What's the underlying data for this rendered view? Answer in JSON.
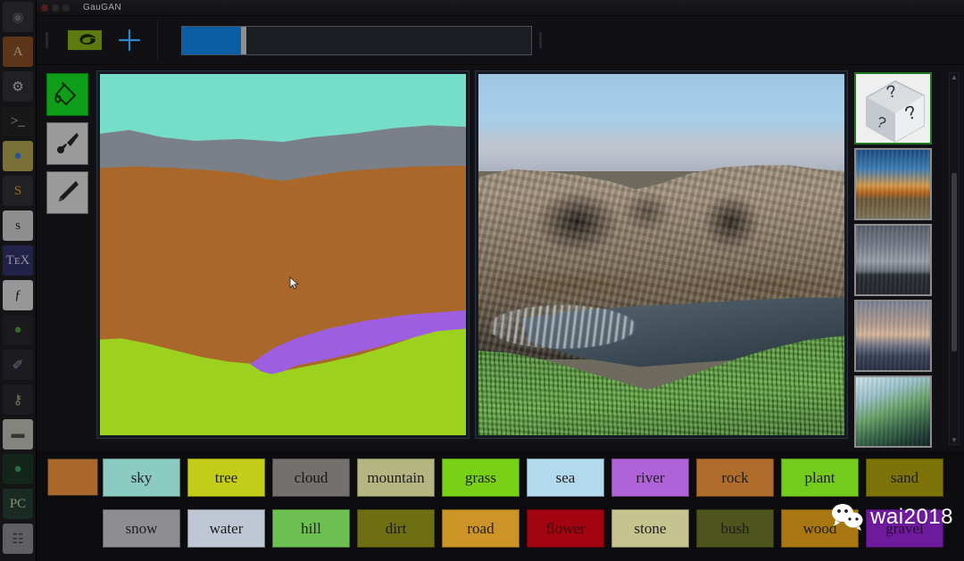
{
  "window": {
    "title": "GauGAN",
    "traffic_lights": [
      "close-button",
      "minimize-button",
      "maximize-button"
    ]
  },
  "toolbar": {
    "brand_icon": "nvidia-eye-logo",
    "new_icon": "plus-icon",
    "slider": {
      "name": "brush-size-slider",
      "value_percent": 17
    }
  },
  "tools": [
    {
      "name": "paint-bucket",
      "icon": "paint-bucket-icon",
      "active": true
    },
    {
      "name": "paintbrush",
      "icon": "paintbrush-icon",
      "active": false
    },
    {
      "name": "pencil",
      "icon": "pencil-icon",
      "active": false
    }
  ],
  "segmentation_canvas": {
    "name": "segmentation-canvas",
    "regions": [
      {
        "label": "sky",
        "color": "#76ddc9"
      },
      {
        "label": "cloud",
        "color": "#7b8088"
      },
      {
        "label": "rock",
        "color": "#a9672a"
      },
      {
        "label": "river",
        "color": "#9d5fe0"
      },
      {
        "label": "tree",
        "color": "#9cd120"
      }
    ],
    "cursor": "arrow-cursor"
  },
  "output_canvas": {
    "name": "generated-image-canvas",
    "description": "photorealistic rocky cliff with river and green grass under blue sky"
  },
  "styles": {
    "scrollbar": {
      "up_arrow": "▲",
      "down_arrow": "▼"
    },
    "thumbnails": [
      {
        "name": "random-style",
        "icon": "question-dice-icon",
        "selected": true
      },
      {
        "name": "style-sunset-lake",
        "selected": false
      },
      {
        "name": "style-overcast-sea",
        "selected": false
      },
      {
        "name": "style-dusk-city",
        "selected": false
      },
      {
        "name": "style-painted-landscape",
        "selected": false
      }
    ]
  },
  "palette": {
    "current_color": "#a9672a",
    "current_color_label": "rock",
    "row1": [
      {
        "label": "sky",
        "color": "#8ccbc1",
        "text": "#1d1d1d"
      },
      {
        "label": "tree",
        "color": "#c3cc16",
        "text": "#1d1d1d"
      },
      {
        "label": "cloud",
        "color": "#73706d",
        "text": "#161616"
      },
      {
        "label": "mountain",
        "color": "#b4b581",
        "text": "#1d1d1d"
      },
      {
        "label": "grass",
        "color": "#79d117",
        "text": "#1d1d1d"
      },
      {
        "label": "sea",
        "color": "#b3d9ec",
        "text": "#1d1d1d"
      },
      {
        "label": "river",
        "color": "#b063d9",
        "text": "#1d1d1d"
      },
      {
        "label": "rock",
        "color": "#b06c2b",
        "text": "#1d1d1d"
      },
      {
        "label": "plant",
        "color": "#73cc1c",
        "text": "#1d1d1d"
      },
      {
        "label": "sand",
        "color": "#7d7308",
        "text": "#1d1d1d"
      }
    ],
    "row2": [
      {
        "label": "snow",
        "color": "#8e8e90",
        "text": "#1d1d1d"
      },
      {
        "label": "water",
        "color": "#c0c7d4",
        "text": "#1d1d1d"
      },
      {
        "label": "hill",
        "color": "#6dbf52",
        "text": "#1d1d1d"
      },
      {
        "label": "dirt",
        "color": "#6e6f12",
        "text": "#1d1d1d"
      },
      {
        "label": "road",
        "color": "#cc9426",
        "text": "#1d1d1d"
      },
      {
        "label": "flower",
        "color": "#a10311",
        "text": "#3a0a0a"
      },
      {
        "label": "stone",
        "color": "#c5c48f",
        "text": "#1d1d1d"
      },
      {
        "label": "bush",
        "color": "#4d541c",
        "text": "#1d1d1d"
      },
      {
        "label": "wood",
        "color": "#a87712",
        "text": "#1d1d1d"
      },
      {
        "label": "gravel",
        "color": "#6d1a9c",
        "text": "#2a0a3a"
      }
    ]
  },
  "watermark": {
    "icon": "wechat-icon",
    "text": "wai2018"
  },
  "dock": [
    {
      "name": "dock-item-system",
      "glyph": "◉",
      "bg": "#2c2c2e",
      "fg": "#6e6e72"
    },
    {
      "name": "dock-item-files",
      "glyph": "A",
      "bg": "#8a4a1c",
      "fg": "#e8d4c0"
    },
    {
      "name": "dock-item-settings",
      "glyph": "⚙",
      "bg": "#2a2a2c",
      "fg": "#cfcfcf"
    },
    {
      "name": "dock-item-terminal",
      "glyph": ">_",
      "bg": "#1b1b1b",
      "fg": "#d8d8d8",
      "running": true
    },
    {
      "name": "dock-item-chrome",
      "glyph": "●",
      "bg": "#b9a84a",
      "fg": "#2b7de9",
      "running": true
    },
    {
      "name": "dock-item-sublime",
      "glyph": "S",
      "bg": "#2a2a2c",
      "fg": "#e8a317"
    },
    {
      "name": "dock-item-skype",
      "glyph": "s",
      "bg": "#d9d9d9",
      "fg": "#1a1a1a"
    },
    {
      "name": "dock-item-texstudio",
      "glyph": "TᴇX",
      "bg": "#2b2a66",
      "fg": "#dcdcf0"
    },
    {
      "name": "dock-item-fontforge",
      "glyph": "ƒ",
      "bg": "#e8e8e8",
      "fg": "#141414"
    },
    {
      "name": "dock-item-gimp",
      "glyph": "●",
      "bg": "#1f1f21",
      "fg": "#4f9a45"
    },
    {
      "name": "dock-item-photo-tool",
      "glyph": "✐",
      "bg": "#242428",
      "fg": "#9aa7c4"
    },
    {
      "name": "dock-item-key-tool",
      "glyph": "⚷",
      "bg": "#242428",
      "fg": "#c0b088"
    },
    {
      "name": "dock-item-archive",
      "glyph": "▬",
      "bg": "#c9c9c0",
      "fg": "#4a4a44"
    },
    {
      "name": "dock-item-anaconda",
      "glyph": "●",
      "bg": "#14321f",
      "fg": "#3fa36b"
    },
    {
      "name": "dock-item-pycharm",
      "glyph": "PC",
      "bg": "#1d3a2b",
      "fg": "#c8e6a0",
      "running": true
    },
    {
      "name": "dock-item-show-apps",
      "glyph": "☷",
      "bg": "#8f8f92",
      "fg": "#3a3a3c",
      "running": true
    }
  ]
}
